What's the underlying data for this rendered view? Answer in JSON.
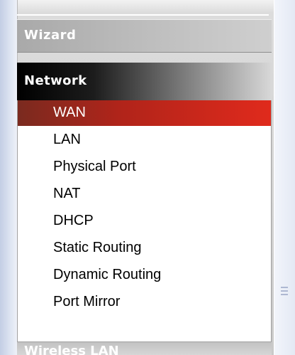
{
  "sidebar": {
    "wizard_label": "Wizard",
    "network_label": "Network",
    "next_section_label": "Wireless LAN",
    "items": [
      {
        "label": "WAN",
        "active": true
      },
      {
        "label": "LAN"
      },
      {
        "label": "Physical Port"
      },
      {
        "label": "NAT"
      },
      {
        "label": "DHCP"
      },
      {
        "label": "Static Routing"
      },
      {
        "label": "Dynamic Routing"
      },
      {
        "label": "Port Mirror"
      }
    ]
  },
  "colors": {
    "active_item": "#e02a1c",
    "section_header_dark": "#000000",
    "panel_gray": "#c9c9c9"
  },
  "icons": {
    "scrollbar_grip": "grip-icon"
  }
}
